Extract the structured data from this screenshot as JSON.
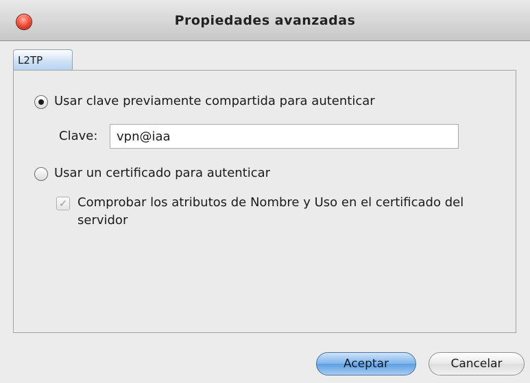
{
  "window": {
    "title": "Propiedades avanzadas"
  },
  "tabs": [
    {
      "label": "L2TP",
      "selected": true
    }
  ],
  "options": {
    "preshared": {
      "label": "Usar clave previamente compartida para autenticar",
      "selected": true
    },
    "key_label": "Clave:",
    "key_value": "vpn@iaa",
    "certificate": {
      "label": "Usar un certificado para autenticar",
      "selected": false
    },
    "verify_server": {
      "label": "Comprobar los atributos de Nombre y Uso en el certificado del servidor",
      "checked": true,
      "enabled": false
    }
  },
  "buttons": {
    "accept_label": "Aceptar",
    "cancel_label": "Cancelar"
  },
  "colors": {
    "primary_button": "#7fb3ea",
    "close_button": "#f2513b",
    "tab_active": "#cfe2f6"
  }
}
